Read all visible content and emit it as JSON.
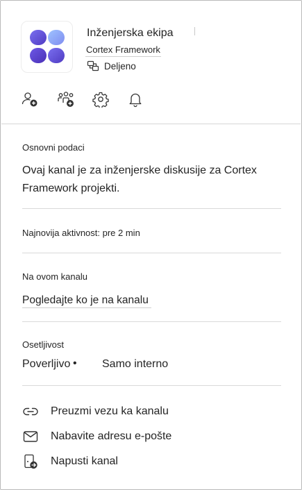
{
  "header": {
    "team_name": "Inženjerska ekipa",
    "channel_name": "Cortex Framework",
    "shared_label": "Deljeno",
    "shared_icon": "shared-channel-icon"
  },
  "actions": [
    {
      "icon": "add-member-icon"
    },
    {
      "icon": "add-team-icon"
    },
    {
      "icon": "gear-icon"
    },
    {
      "icon": "bell-icon"
    }
  ],
  "about": {
    "label": "Osnovni podaci",
    "description": "Ovaj kanal je za inženjerske diskusije za Cortex Framework projekti."
  },
  "activity": {
    "text": "Najnovija aktivnost: pre 2 min"
  },
  "members": {
    "label": "Na ovom kanalu",
    "link": "Pogledajte ko je na kanalu"
  },
  "sensitivity": {
    "label": "Osetljivost",
    "value": "Poverljivo",
    "separator": "•",
    "detail": "Samo interno"
  },
  "menu": [
    {
      "icon": "link-icon",
      "label": "Preuzmi vezu ka kanalu"
    },
    {
      "icon": "mail-icon",
      "label": "Nabavite adresu e-pošte"
    },
    {
      "icon": "leave-icon",
      "label": "Napusti kanal"
    }
  ],
  "colors": {
    "logo_light": "#8fb0f5",
    "logo_mid": "#6a6ee8",
    "logo_dark": "#5a3fc9",
    "text": "#242424",
    "divider": "#d9d9d9"
  }
}
